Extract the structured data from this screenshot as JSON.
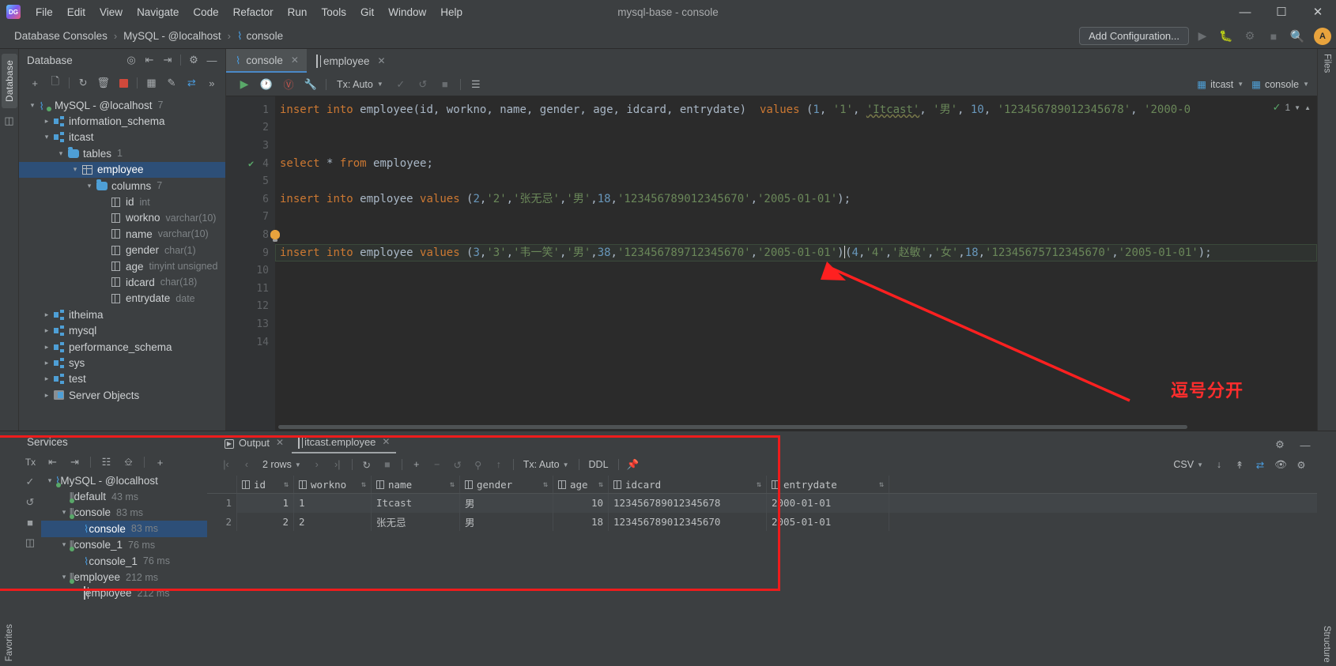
{
  "window": {
    "title": "mysql-base - console",
    "minimize": "—",
    "maximize": "☐",
    "close": "✕"
  },
  "menu": {
    "items": [
      "File",
      "Edit",
      "View",
      "Navigate",
      "Code",
      "Refactor",
      "Run",
      "Tools",
      "Git",
      "Window",
      "Help"
    ]
  },
  "breadcrumb": {
    "items": [
      "Database Consoles",
      "MySQL - @localhost",
      "console"
    ],
    "separator": "›"
  },
  "navbar": {
    "add_configuration": "Add Configuration...",
    "icons": [
      "run-icon",
      "debug-icon",
      "profile-icon",
      "stop-icon",
      "search-icon"
    ],
    "avatar_initial": "A"
  },
  "database_panel": {
    "title": "Database",
    "header_icons": [
      "target-icon",
      "expand-all-icon",
      "collapse-all-icon",
      "gear-icon",
      "hide-icon"
    ],
    "toolbar_icons": [
      "add-icon",
      "copy-icon",
      "refresh-icon",
      "sync-icon",
      "stop-icon",
      "table-icon",
      "edit-icon",
      "jump-icon",
      "more-icon"
    ],
    "tree": [
      {
        "label": "MySQL - @localhost",
        "sub": "7",
        "indent": 0,
        "icon": "connection-icon",
        "arrow": "⌄",
        "selected": false
      },
      {
        "label": "information_schema",
        "sub": "",
        "indent": 1,
        "icon": "schema-icon",
        "arrow": "›",
        "selected": false
      },
      {
        "label": "itcast",
        "sub": "",
        "indent": 1,
        "icon": "schema-icon",
        "arrow": "⌄",
        "selected": false
      },
      {
        "label": "tables",
        "sub": "1",
        "indent": 2,
        "icon": "folder-icon",
        "arrow": "⌄",
        "selected": false
      },
      {
        "label": "employee",
        "sub": "",
        "indent": 3,
        "icon": "table-icon",
        "arrow": "⌄",
        "selected": true
      },
      {
        "label": "columns",
        "sub": "7",
        "indent": 4,
        "icon": "folder-icon",
        "arrow": "⌄",
        "selected": false
      },
      {
        "label": "id",
        "sub": "int",
        "indent": 5,
        "icon": "column-icon",
        "arrow": "",
        "selected": false
      },
      {
        "label": "workno",
        "sub": "varchar(10)",
        "indent": 5,
        "icon": "column-icon",
        "arrow": "",
        "selected": false
      },
      {
        "label": "name",
        "sub": "varchar(10)",
        "indent": 5,
        "icon": "column-icon",
        "arrow": "",
        "selected": false
      },
      {
        "label": "gender",
        "sub": "char(1)",
        "indent": 5,
        "icon": "column-icon",
        "arrow": "",
        "selected": false
      },
      {
        "label": "age",
        "sub": "tinyint unsigned",
        "indent": 5,
        "icon": "column-icon",
        "arrow": "",
        "selected": false
      },
      {
        "label": "idcard",
        "sub": "char(18)",
        "indent": 5,
        "icon": "column-icon",
        "arrow": "",
        "selected": false
      },
      {
        "label": "entrydate",
        "sub": "date",
        "indent": 5,
        "icon": "column-icon",
        "arrow": "",
        "selected": false
      },
      {
        "label": "itheima",
        "sub": "",
        "indent": 1,
        "icon": "schema-icon",
        "arrow": "›",
        "selected": false
      },
      {
        "label": "mysql",
        "sub": "",
        "indent": 1,
        "icon": "schema-icon",
        "arrow": "›",
        "selected": false
      },
      {
        "label": "performance_schema",
        "sub": "",
        "indent": 1,
        "icon": "schema-icon",
        "arrow": "›",
        "selected": false
      },
      {
        "label": "sys",
        "sub": "",
        "indent": 1,
        "icon": "schema-icon",
        "arrow": "›",
        "selected": false
      },
      {
        "label": "test",
        "sub": "",
        "indent": 1,
        "icon": "schema-icon",
        "arrow": "›",
        "selected": false
      },
      {
        "label": "Server Objects",
        "sub": "",
        "indent": 1,
        "icon": "server-objects-icon",
        "arrow": "›",
        "selected": false
      }
    ]
  },
  "side_strip": {
    "database_tab": "Database"
  },
  "right_strip": {
    "tabs": [
      "Files",
      "..."
    ]
  },
  "editor_tabs": [
    {
      "label": "console",
      "icon": "console-icon",
      "active": true,
      "close": "✕"
    },
    {
      "label": "employee",
      "icon": "table-icon",
      "active": false,
      "close": "✕"
    }
  ],
  "run_toolbar": {
    "tx_mode": "Tx: Auto",
    "icons": [
      "run-icon",
      "history-icon",
      "explain-icon",
      "wrench-icon",
      "commit-icon",
      "rollback-icon",
      "stop-icon",
      "table-mode-icon"
    ],
    "schema_chip": "itcast",
    "session_chip": "console"
  },
  "editor": {
    "inspections": {
      "errors": "1",
      "check": "✓"
    },
    "lines": [
      {
        "n": 1,
        "mark": "",
        "tokens": [
          {
            "t": "insert",
            "c": "kw"
          },
          {
            "t": " ",
            "c": "pun"
          },
          {
            "t": "into",
            "c": "kw"
          },
          {
            "t": " ",
            "c": "pun"
          },
          {
            "t": "employee",
            "c": "id"
          },
          {
            "t": "(",
            "c": "pun"
          },
          {
            "t": "id",
            "c": "id"
          },
          {
            "t": ", ",
            "c": "pun"
          },
          {
            "t": "workno",
            "c": "id"
          },
          {
            "t": ", ",
            "c": "pun"
          },
          {
            "t": "name",
            "c": "id"
          },
          {
            "t": ", ",
            "c": "pun"
          },
          {
            "t": "gender",
            "c": "id"
          },
          {
            "t": ", ",
            "c": "pun"
          },
          {
            "t": "age",
            "c": "id"
          },
          {
            "t": ", ",
            "c": "pun"
          },
          {
            "t": "idcard",
            "c": "id"
          },
          {
            "t": ", ",
            "c": "pun"
          },
          {
            "t": "entrydate",
            "c": "id"
          },
          {
            "t": ")",
            "c": "pun"
          },
          {
            "t": "  ",
            "c": "pun"
          },
          {
            "t": "values",
            "c": "kw"
          },
          {
            "t": " (",
            "c": "pun"
          },
          {
            "t": "1",
            "c": "num"
          },
          {
            "t": ", ",
            "c": "pun"
          },
          {
            "t": "'1'",
            "c": "str"
          },
          {
            "t": ", ",
            "c": "pun"
          },
          {
            "t": "'Itcast'",
            "c": "str wavy"
          },
          {
            "t": ", ",
            "c": "pun"
          },
          {
            "t": "'男'",
            "c": "str"
          },
          {
            "t": ", ",
            "c": "pun"
          },
          {
            "t": "10",
            "c": "num"
          },
          {
            "t": ", ",
            "c": "pun"
          },
          {
            "t": "'123456789012345678'",
            "c": "str"
          },
          {
            "t": ", ",
            "c": "pun"
          },
          {
            "t": "'2000-0",
            "c": "str"
          }
        ]
      },
      {
        "n": 2,
        "mark": "",
        "tokens": []
      },
      {
        "n": 3,
        "mark": "",
        "tokens": []
      },
      {
        "n": 4,
        "mark": "ok",
        "tokens": [
          {
            "t": "select",
            "c": "kw"
          },
          {
            "t": " ",
            "c": "pun"
          },
          {
            "t": "*",
            "c": "pun"
          },
          {
            "t": " ",
            "c": "pun"
          },
          {
            "t": "from",
            "c": "kw"
          },
          {
            "t": " ",
            "c": "pun"
          },
          {
            "t": "employee",
            "c": "id"
          },
          {
            "t": ";",
            "c": "pun"
          }
        ]
      },
      {
        "n": 5,
        "mark": "",
        "tokens": []
      },
      {
        "n": 6,
        "mark": "",
        "tokens": [
          {
            "t": "insert",
            "c": "kw"
          },
          {
            "t": " ",
            "c": "pun"
          },
          {
            "t": "into",
            "c": "kw"
          },
          {
            "t": " ",
            "c": "pun"
          },
          {
            "t": "employee",
            "c": "id"
          },
          {
            "t": " ",
            "c": "pun"
          },
          {
            "t": "values",
            "c": "kw"
          },
          {
            "t": " (",
            "c": "pun"
          },
          {
            "t": "2",
            "c": "num"
          },
          {
            "t": ",",
            "c": "pun"
          },
          {
            "t": "'2'",
            "c": "str"
          },
          {
            "t": ",",
            "c": "pun"
          },
          {
            "t": "'张无忌'",
            "c": "str"
          },
          {
            "t": ",",
            "c": "pun"
          },
          {
            "t": "'男'",
            "c": "str"
          },
          {
            "t": ",",
            "c": "pun"
          },
          {
            "t": "18",
            "c": "num"
          },
          {
            "t": ",",
            "c": "pun"
          },
          {
            "t": "'123456789012345670'",
            "c": "str"
          },
          {
            "t": ",",
            "c": "pun"
          },
          {
            "t": "'2005-01-01'",
            "c": "str"
          },
          {
            "t": ");",
            "c": "pun"
          }
        ]
      },
      {
        "n": 7,
        "mark": "",
        "tokens": []
      },
      {
        "n": 8,
        "mark": "bulb",
        "tokens": []
      },
      {
        "n": 9,
        "mark": "",
        "highlight": true,
        "tokens": [
          {
            "t": "insert",
            "c": "kw"
          },
          {
            "t": " ",
            "c": "pun"
          },
          {
            "t": "into",
            "c": "kw"
          },
          {
            "t": " ",
            "c": "pun"
          },
          {
            "t": "employee",
            "c": "id"
          },
          {
            "t": " ",
            "c": "pun"
          },
          {
            "t": "values",
            "c": "kw"
          },
          {
            "t": " (",
            "c": "pun"
          },
          {
            "t": "3",
            "c": "num"
          },
          {
            "t": ",",
            "c": "pun"
          },
          {
            "t": "'3'",
            "c": "str"
          },
          {
            "t": ",",
            "c": "pun"
          },
          {
            "t": "'韦一笑'",
            "c": "str"
          },
          {
            "t": ",",
            "c": "pun"
          },
          {
            "t": "'男'",
            "c": "str"
          },
          {
            "t": ",",
            "c": "pun"
          },
          {
            "t": "38",
            "c": "num"
          },
          {
            "t": ",",
            "c": "pun"
          },
          {
            "t": "'123456789712345670'",
            "c": "str"
          },
          {
            "t": ",",
            "c": "pun"
          },
          {
            "t": "'2005-01-01'",
            "c": "str"
          },
          {
            "t": ")",
            "c": "pun"
          },
          {
            "t": "|CARET|",
            "c": "caret"
          },
          {
            "t": "(",
            "c": "pun"
          },
          {
            "t": "4",
            "c": "num"
          },
          {
            "t": ",",
            "c": "pun"
          },
          {
            "t": "'4'",
            "c": "str"
          },
          {
            "t": ",",
            "c": "pun"
          },
          {
            "t": "'赵敏'",
            "c": "str"
          },
          {
            "t": ",",
            "c": "pun"
          },
          {
            "t": "'女'",
            "c": "str"
          },
          {
            "t": ",",
            "c": "pun"
          },
          {
            "t": "18",
            "c": "num"
          },
          {
            "t": ",",
            "c": "pun"
          },
          {
            "t": "'12345675712345670'",
            "c": "str"
          },
          {
            "t": ",",
            "c": "pun"
          },
          {
            "t": "'2005-01-01'",
            "c": "str"
          },
          {
            "t": ");",
            "c": "pun"
          }
        ]
      },
      {
        "n": 10,
        "mark": "",
        "tokens": []
      },
      {
        "n": 11,
        "mark": "",
        "tokens": []
      },
      {
        "n": 12,
        "mark": "",
        "tokens": []
      },
      {
        "n": 13,
        "mark": "",
        "tokens": []
      },
      {
        "n": 14,
        "mark": "",
        "tokens": []
      }
    ]
  },
  "annotation": {
    "text": "逗号分开",
    "color": "#ff2d2d"
  },
  "services": {
    "title": "Services",
    "toolbar_icons": [
      "tx-icon",
      "expand-all-icon",
      "collapse-all-icon",
      "group-icon",
      "new-tab-icon",
      "add-icon"
    ],
    "side_icons": [
      "commit-icon",
      "rollback-icon",
      "stop-icon",
      "layout-icon"
    ],
    "tree": [
      {
        "label": "MySQL - @localhost",
        "sub": "",
        "indent": 0,
        "icon": "connection-icon",
        "arrow": "⌄",
        "selected": false
      },
      {
        "label": "default",
        "sub": "43 ms",
        "indent": 1,
        "icon": "session-icon",
        "arrow": "",
        "selected": false
      },
      {
        "label": "console",
        "sub": "83 ms",
        "indent": 1,
        "icon": "session-icon",
        "arrow": "⌄",
        "selected": false
      },
      {
        "label": "console",
        "sub": "83 ms",
        "indent": 2,
        "icon": "console-icon",
        "arrow": "",
        "selected": true
      },
      {
        "label": "console_1",
        "sub": "76 ms",
        "indent": 1,
        "icon": "session-icon",
        "arrow": "⌄",
        "selected": false
      },
      {
        "label": "console_1",
        "sub": "76 ms",
        "indent": 2,
        "icon": "console-icon",
        "arrow": "",
        "selected": false
      },
      {
        "label": "employee",
        "sub": "212 ms",
        "indent": 1,
        "icon": "session-icon",
        "arrow": "⌄",
        "selected": false
      },
      {
        "label": "employee",
        "sub": "212 ms",
        "indent": 2,
        "icon": "table-icon",
        "arrow": "",
        "selected": false
      }
    ]
  },
  "result": {
    "tabs": [
      {
        "label": "Output",
        "icon": "output-icon",
        "active": false,
        "close": "✕"
      },
      {
        "label": "itcast.employee",
        "icon": "table-icon",
        "active": true,
        "close": "✕"
      }
    ],
    "toolbar": {
      "first": "|‹",
      "prev": "‹",
      "rows_label": "2 rows",
      "next": "›",
      "last": "›|",
      "reload": "reload-icon",
      "stop": "stop-icon",
      "add_row": "+",
      "delete_row": "−",
      "revert": "revert-icon",
      "find": "find-icon",
      "submit": "submit-icon",
      "tx_mode": "Tx: Auto",
      "ddl": "DDL",
      "pin": "pin-icon",
      "export_format": "CSV",
      "right_icons": [
        "download-icon",
        "upload-icon",
        "diagram-icon",
        "view-icon",
        "settings-icon"
      ]
    },
    "columns": [
      "id",
      "workno",
      "name",
      "gender",
      "age",
      "idcard",
      "entrydate"
    ],
    "rows": [
      {
        "idx": "1",
        "id": "1",
        "workno": "1",
        "name": "Itcast",
        "gender": "男",
        "age": "10",
        "idcard": "123456789012345678",
        "entrydate": "2000-01-01"
      },
      {
        "idx": "2",
        "id": "2",
        "workno": "2",
        "name": "张无忌",
        "gender": "男",
        "age": "18",
        "idcard": "123456789012345670",
        "entrydate": "2005-01-01"
      }
    ]
  },
  "status_strips": {
    "favorites": "Favorites",
    "structure": "Structure",
    "files": "Files"
  }
}
